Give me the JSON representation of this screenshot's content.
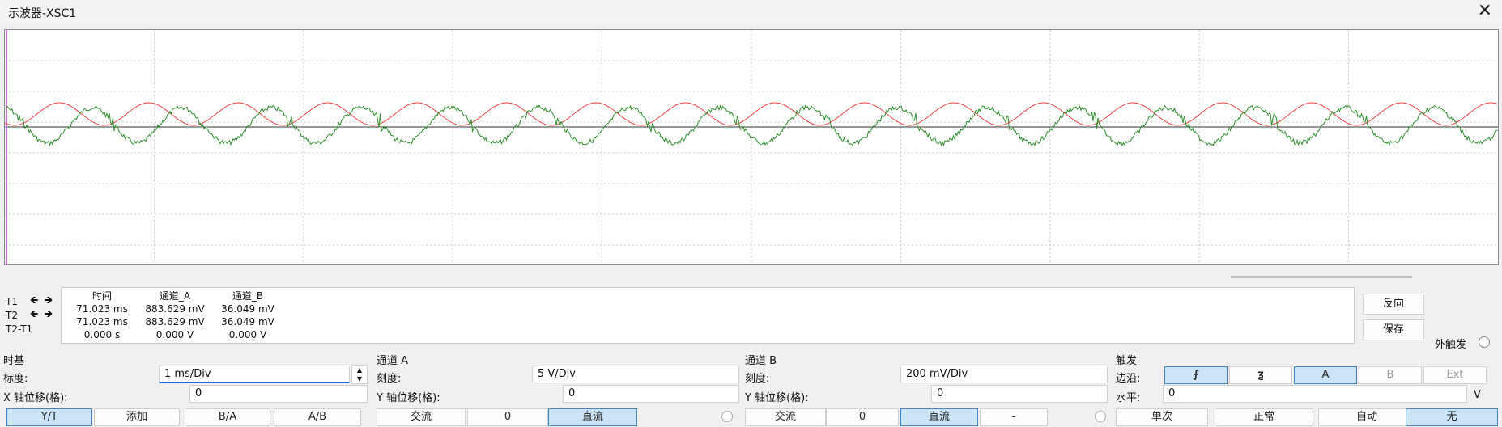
{
  "window": {
    "title": "示波器-XSC1",
    "close_glyph": "✕"
  },
  "colors": {
    "channel_a": "#e84545",
    "channel_b": "#2f8f2f",
    "grid": "#c8c8c8",
    "selected_button": "#cce4f7"
  },
  "readout": {
    "rows": [
      {
        "label": "T1",
        "time": "71.023 ms",
        "a": "883.629 mV",
        "b": "36.049 mV"
      },
      {
        "label": "T2",
        "time": "71.023 ms",
        "a": "883.629 mV",
        "b": "36.049 mV"
      },
      {
        "label": "T2-T1",
        "time": "0.000 s",
        "a": "0.000 V",
        "b": "0.000 V"
      }
    ],
    "headers": {
      "time": "时间",
      "a": "通道_A",
      "b": "通道_B"
    },
    "arrow_left": "🡸",
    "arrow_right": "🡺"
  },
  "side": {
    "reverse": "反向",
    "save": "保存",
    "ext_trigger": "外触发"
  },
  "timebase": {
    "title": "时基",
    "scale_label": "标度:",
    "scale_value": "1 ms/Div",
    "xpos_label": "X 轴位移(格):",
    "xpos_value": "0",
    "modes": [
      "Y/T",
      "添加",
      "B/A",
      "A/B"
    ],
    "selected_mode": "Y/T"
  },
  "channel_a": {
    "title": "通道 A",
    "scale_label": "刻度:",
    "scale_value": "5  V/Div",
    "ypos_label": "Y 轴位移(格):",
    "ypos_value": "0",
    "coupling": [
      "交流",
      "0",
      "直流"
    ],
    "selected_coupling": "直流"
  },
  "channel_b": {
    "title": "通道 B",
    "scale_label": "刻度:",
    "scale_value": "200 mV/Div",
    "ypos_label": "Y 轴位移(格):",
    "ypos_value": "0",
    "coupling": [
      "交流",
      "0",
      "直流",
      "-"
    ],
    "selected_coupling": "直流"
  },
  "trigger": {
    "title": "触发",
    "edge_label": "边沿:",
    "edge_rising": "⨍",
    "edge_falling": "ƺ",
    "sources": [
      "A",
      "B",
      "Ext"
    ],
    "selected_source": "A",
    "level_label": "水平:",
    "level_value": "0",
    "level_unit": "V",
    "modes": [
      "单次",
      "正常",
      "自动",
      "无"
    ],
    "selected_mode": "无"
  }
}
